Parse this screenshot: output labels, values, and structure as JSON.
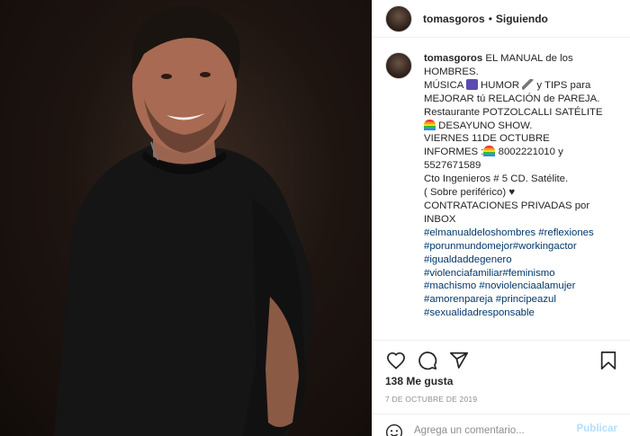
{
  "post": {
    "image_alt": "Man in black t-shirt smiling",
    "author": "tomasgoros",
    "dot": "•",
    "follow_label": "Siguiendo"
  },
  "caption": {
    "username": "tomasgoros",
    "lines": [
      "EL MANUAL de los",
      "HOMBRES.",
      "MÚSICA",
      "HUMOR",
      "y TIPS para",
      "MEJORAR tú RELACIÓN de PAREJA.",
      "Restaurante POTZOLCALLI SATÉLITE",
      "DESAYUNO SHOW.",
      "VIERNES 11DE OCTUBRE",
      "INFORMES :",
      "8002221010 y",
      "5527671589",
      "Cto Ingenieros # 5 CD. Satélite.",
      "( Sobre periférico) ♥",
      "CONTRATACIONES PRIVADAS por",
      "INBOX"
    ],
    "hashtags": [
      "#elmanualdeloshombres #reflexiones",
      "#porunmundomejor#workingactor",
      "#igualdaddegenero",
      "#violenciafamiliar#feminismo",
      "#machismo #noviolenciaalamujer",
      "#amorenpareja #principeazul",
      "#sexualidadresponsable"
    ]
  },
  "stats": {
    "likes": "138 Me gusta",
    "date": "7 DE OCTUBRE DE 2019"
  },
  "comment_box": {
    "placeholder": "Agrega un comentario...",
    "publish_label": "Publicar"
  },
  "icons": {
    "like": "heart-icon",
    "comment": "comment-icon",
    "share": "share-icon",
    "save": "bookmark-icon",
    "emoji": "emoji-icon"
  },
  "colors": {
    "hashtag": "#00376b",
    "publish_disabled": "#b2dffc",
    "muted": "#8e8e8e"
  }
}
